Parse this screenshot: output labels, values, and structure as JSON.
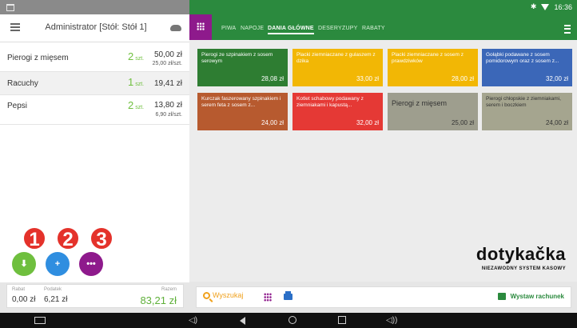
{
  "status": {
    "time": "16:36",
    "bluetooth_icon": "bluetooth-icon",
    "wifi_icon": "wifi-icon"
  },
  "header": {
    "title": "Administrator [Stół: Stół 1]"
  },
  "order": {
    "items": [
      {
        "name": "Pierogi z mięsem",
        "qty": "2",
        "qty_unit": "szt.",
        "price": "50,00 zł",
        "unit_price": "25,00 zł/szt."
      },
      {
        "name": "Racuchy",
        "qty": "1",
        "qty_unit": "szt.",
        "price": "19,41 zł",
        "unit_price": ""
      },
      {
        "name": "Pepsi",
        "qty": "2",
        "qty_unit": "szt.",
        "price": "13,80 zł",
        "unit_price": "6,90 zł/szt."
      }
    ]
  },
  "actions": {
    "download_label": "⬇",
    "add_label": "+",
    "more_label": "•••",
    "badges": [
      "1",
      "2",
      "3"
    ]
  },
  "totals": {
    "discount_label": "Rabat",
    "discount_value": "0,00 zł",
    "tax_label": "Podatek",
    "tax_value": "6,21 zł",
    "total_label": "Razem",
    "total_value": "83,21 zł"
  },
  "categories": [
    {
      "label": "PIWA",
      "active": false
    },
    {
      "label": "NAPOJE",
      "active": false
    },
    {
      "label": "DANIA GŁÓWNE",
      "active": true
    },
    {
      "label": "DESERY",
      "active": false
    },
    {
      "label": "ZUPY",
      "active": false
    },
    {
      "label": "RABATY",
      "active": false
    }
  ],
  "products": [
    {
      "name": "Pierogi ze szpinakiem z sosem serowym",
      "price": "28,08 zł",
      "color": "#2e7d32"
    },
    {
      "name": "Placki ziemniaczane z gulaszem z dzika",
      "price": "33,00 zł",
      "color": "#f2b705"
    },
    {
      "name": "Placki ziemniaczane z sosem z prawdziwków",
      "price": "28,00 zł",
      "color": "#f2b705"
    },
    {
      "name": "Gołąbki podawane z sosem pomidorowym oraz z sosem z...",
      "price": "32,00 zł",
      "color": "#3b67b8"
    },
    {
      "name": "Kurczak faszerowany szpinakiem i serem feta z sosem z...",
      "price": "24,00 zł",
      "color": "#b75a2f"
    },
    {
      "name": "Kotlet schabowy podawany z ziemniakami i kapustą...",
      "price": "32,00 zł",
      "color": "#e53935"
    },
    {
      "name": "Pierogi z mięsem",
      "price": "25,00 zł",
      "color": "#9e9e8e"
    },
    {
      "name": "Pierogi chłopskie z ziemniakami, serem i boczkiem",
      "price": "24,00 zł",
      "color": "#a5a58f"
    }
  ],
  "logo": {
    "main": "dotykačka",
    "sub": "NIEZAWODNY SYSTEM KASOWY"
  },
  "bottom": {
    "search_label": "Wyszukaj",
    "invoice_label": "Wystaw rachunek"
  }
}
